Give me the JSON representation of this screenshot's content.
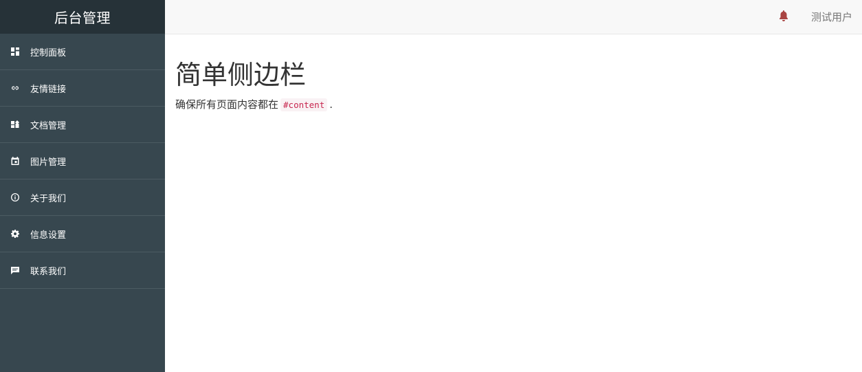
{
  "sidebar": {
    "brand": "后台管理",
    "items": [
      {
        "label": "控制面板",
        "icon": "dashboard-icon"
      },
      {
        "label": "友情链接",
        "icon": "link-icon"
      },
      {
        "label": "文档管理",
        "icon": "documents-icon"
      },
      {
        "label": "图片管理",
        "icon": "calendar-icon"
      },
      {
        "label": "关于我们",
        "icon": "info-icon"
      },
      {
        "label": "信息设置",
        "icon": "gear-icon"
      },
      {
        "label": "联系我们",
        "icon": "chat-icon"
      }
    ]
  },
  "topbar": {
    "bell_icon": "bell-icon",
    "user": "测试用户"
  },
  "main": {
    "title": "简单侧边栏",
    "desc_before": "确保所有页面内容都在",
    "desc_code": "#content",
    "desc_after": "."
  },
  "colors": {
    "sidebar_bg": "#37474f",
    "brand_bg": "#263238",
    "bell": "#a94442",
    "code_text": "#c7254e"
  }
}
